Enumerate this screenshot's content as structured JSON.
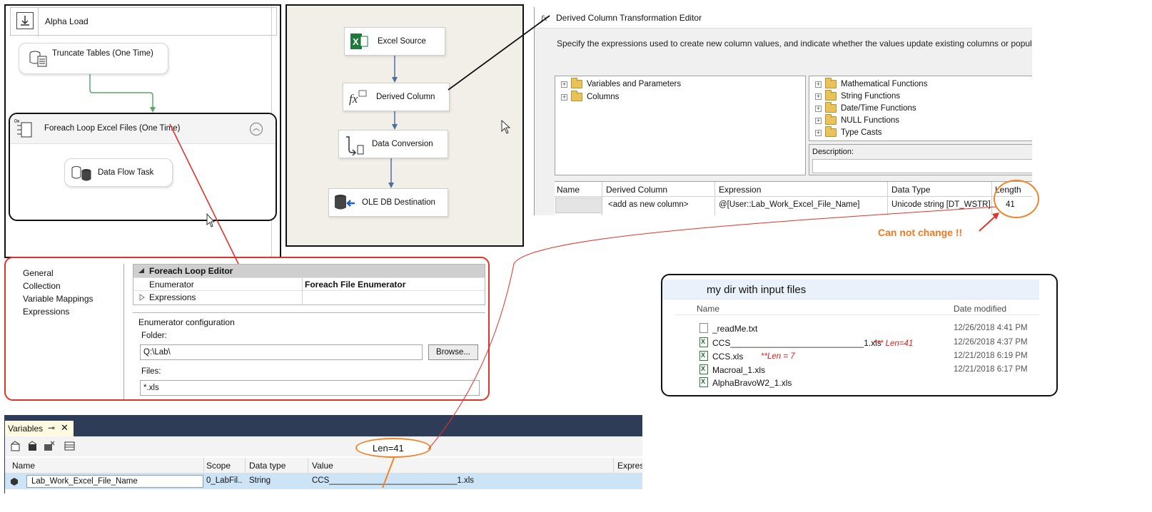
{
  "control_flow": {
    "header_title": "Alpha Load",
    "truncate_task": "Truncate Tables (One Time)",
    "foreach_container": "Foreach Loop Excel Files (One Time)",
    "data_flow_task": "Data Flow Task"
  },
  "data_flow": {
    "source": "Excel Source",
    "derived": "Derived Column",
    "conversion": "Data Conversion",
    "destination": "OLE DB Destination"
  },
  "derived_editor": {
    "title": "Derived Column Transformation Editor",
    "description": "Specify the expressions used to create new column values, and indicate whether the values update existing columns or populate ne",
    "left_tree": [
      "Variables and Parameters",
      "Columns"
    ],
    "right_tree": [
      "Mathematical Functions",
      "String Functions",
      "Date/Time Functions",
      "NULL Functions",
      "Type Casts"
    ],
    "description_label": "Description:",
    "grid_headers": [
      "Name",
      "Derived Column",
      "Expression",
      "Data Type",
      "Length"
    ],
    "grid_row": {
      "derived_column": "<add as new column>",
      "expression": "@[User::Lab_Work_Excel_File_Name]",
      "data_type": "Unicode string [DT_WSTR]",
      "length": "41"
    }
  },
  "annotations": {
    "cannot_change": "Can not change !!",
    "len41_bubble": "Len=41",
    "len41_note": "*** Len=41",
    "len7_note": "**Len = 7",
    "accent_color": "#f0852a",
    "red_color": "#e0332a"
  },
  "dir_panel": {
    "title": "my dir with input files",
    "col_name": "Name",
    "col_date": "Date modified",
    "files": [
      {
        "name": "_readMe.txt",
        "date": "12/26/2018 4:41 PM",
        "icon": "text-file-icon"
      },
      {
        "name": "CCS____________________________1.xls",
        "date": "12/26/2018 4:37 PM",
        "icon": "excel-file-icon"
      },
      {
        "name": "CCS.xls",
        "date": "12/21/2018 6:19 PM",
        "icon": "excel-file-icon"
      },
      {
        "name": "Macroal_1.xls",
        "date": "12/21/2018 6:17 PM",
        "icon": "excel-file-icon"
      },
      {
        "name": "AlphaBravoW2_1.xls",
        "date": "",
        "icon": "excel-file-icon"
      }
    ]
  },
  "foreach_editor": {
    "nav": [
      "General",
      "Collection",
      "Variable Mappings",
      "Expressions"
    ],
    "prop_title": "Foreach Loop Editor",
    "rows": [
      {
        "key": "Enumerator",
        "value": "Foreach File Enumerator"
      },
      {
        "key": "Expressions",
        "value": ""
      }
    ],
    "enum_config_title": "Enumerator configuration",
    "folder_label": "Folder:",
    "folder_value": "Q:\\Lab\\",
    "browse_label": "Browse...",
    "files_label": "Files:",
    "files_value": "*.xls"
  },
  "variables": {
    "tab_label": "Variables",
    "headers": [
      "Name",
      "Scope",
      "Data type",
      "Value",
      "Express"
    ],
    "row": {
      "name": "Lab_Work_Excel_File_Name",
      "scope": "0_LabFil..",
      "type": "String",
      "value": "CCS____________________________1.xls"
    }
  }
}
